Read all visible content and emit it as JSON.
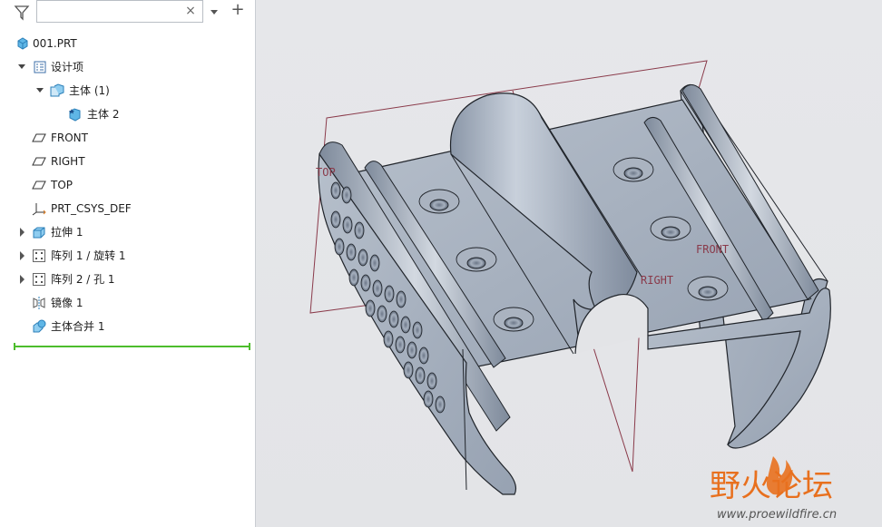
{
  "toolbar": {
    "search_value": "",
    "filter_icon": "filter-icon",
    "clear_glyph": "×",
    "add_glyph": "+"
  },
  "model_tree": {
    "root": "001.PRT",
    "items": [
      {
        "label": "设计项",
        "icon": "design-items-icon",
        "expand": "expanded"
      },
      {
        "label": "主体 (1)",
        "icon": "body-folder-icon",
        "expand": "expanded"
      },
      {
        "label": "主体 2",
        "icon": "body-icon",
        "expand": "none"
      },
      {
        "label": "FRONT",
        "icon": "datum-plane-icon",
        "expand": "none"
      },
      {
        "label": "RIGHT",
        "icon": "datum-plane-icon",
        "expand": "none"
      },
      {
        "label": "TOP",
        "icon": "datum-plane-icon",
        "expand": "none"
      },
      {
        "label": "PRT_CSYS_DEF",
        "icon": "coordinate-system-icon",
        "expand": "none"
      },
      {
        "label": "拉伸 1",
        "icon": "extrude-icon",
        "expand": "collapsed"
      },
      {
        "label": "阵列 1 / 旋转 1",
        "icon": "pattern-icon",
        "expand": "collapsed"
      },
      {
        "label": "阵列 2 / 孔 1",
        "icon": "pattern-icon",
        "expand": "collapsed"
      },
      {
        "label": "镜像 1",
        "icon": "mirror-icon",
        "expand": "none"
      },
      {
        "label": "主体合并 1",
        "icon": "body-merge-icon",
        "expand": "none"
      }
    ]
  },
  "viewport": {
    "plane_labels": {
      "top": "TOP",
      "front": "FRONT",
      "right": "RIGHT"
    },
    "colors": {
      "background": "#e4e5e8",
      "part": "#a3adbb",
      "plane": "#8a3a4a",
      "edge": "#20242a"
    }
  },
  "watermark": {
    "title": "野火论坛",
    "url": "www.proewildfire.cn",
    "accent": "#e8701e"
  }
}
